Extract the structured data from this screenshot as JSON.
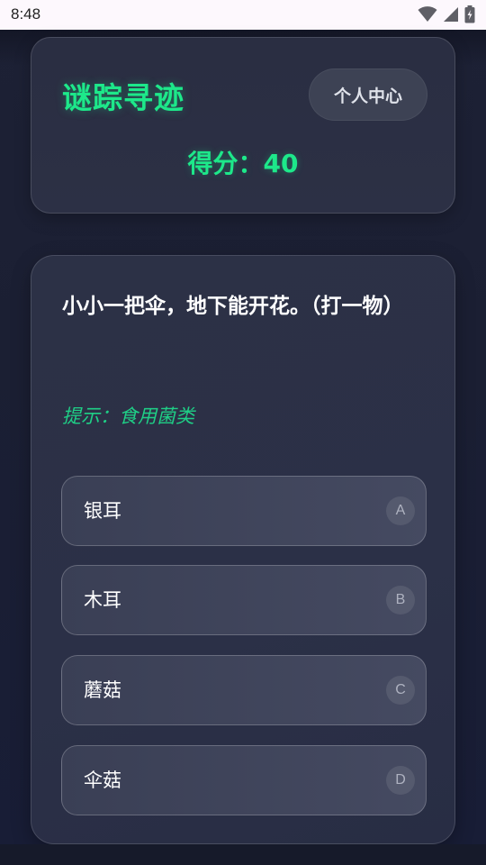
{
  "status_bar": {
    "time": "8:48",
    "icons": [
      "wifi-icon",
      "cell-signal-icon",
      "battery-icon"
    ]
  },
  "header": {
    "title": "谜踪寻迹",
    "profile_button_label": "个人中心",
    "score_label": "得分：40"
  },
  "question": {
    "riddle": "小小一把伞，地下能开花。（打一物）",
    "hint": "提示：食用菌类",
    "options": [
      {
        "label": "银耳",
        "letter": "A"
      },
      {
        "label": "木耳",
        "letter": "B"
      },
      {
        "label": "蘑菇",
        "letter": "C"
      },
      {
        "label": "伞菇",
        "letter": "D"
      }
    ]
  },
  "colors": {
    "accent_green": "#1de88a",
    "hint_green": "#1fcf86",
    "background": "#1d2135",
    "card": "#2c3045"
  }
}
